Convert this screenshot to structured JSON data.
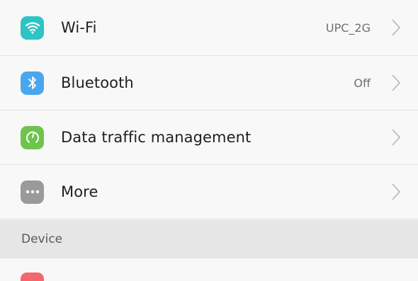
{
  "wireless": {
    "items": [
      {
        "label": "Wi-Fi",
        "value": "UPC_2G",
        "icon": "wifi-icon",
        "color": "#2cc4c4"
      },
      {
        "label": "Bluetooth",
        "value": "Off",
        "icon": "bluetooth-icon",
        "color": "#4aa7ee"
      },
      {
        "label": "Data traffic management",
        "value": "",
        "icon": "data-usage-icon",
        "color": "#6ec44c"
      },
      {
        "label": "More",
        "value": "",
        "icon": "more-icon",
        "color": "#9a9a9a"
      }
    ]
  },
  "device_section": {
    "title": "Device"
  },
  "next_item": {
    "icon": "next-item-icon",
    "color": "#f2686e"
  }
}
